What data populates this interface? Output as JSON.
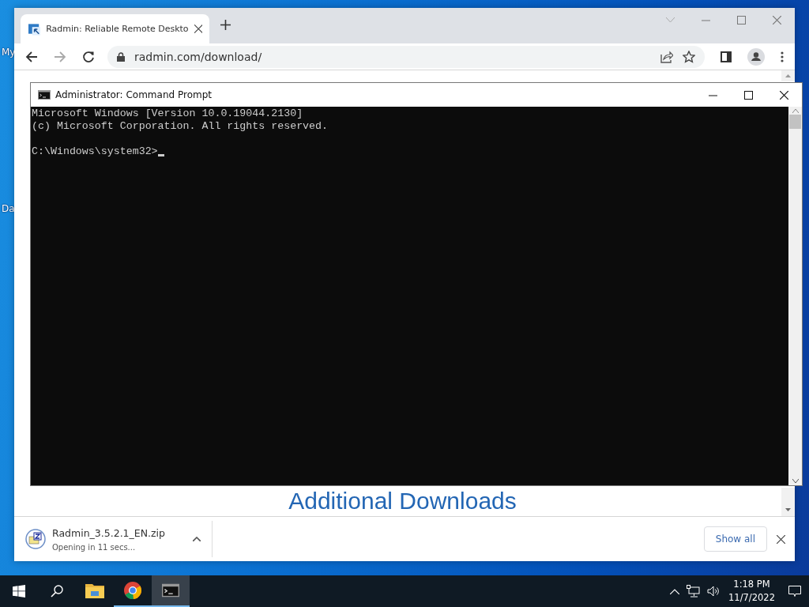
{
  "desktop": {
    "icons": [
      {
        "label": "My"
      },
      {
        "label": "Da"
      }
    ]
  },
  "browser": {
    "tabs": [
      {
        "title": "Radmin: Reliable Remote Deskto",
        "selected": true
      }
    ],
    "url": "radmin.com/download/",
    "page": {
      "heading": "Additional Downloads"
    },
    "download": {
      "filename": "Radmin_3.5.2.1_EN.zip",
      "status": "Opening in 11 secs...",
      "button": "Show all"
    }
  },
  "console": {
    "title": "Administrator: Command Prompt",
    "output": [
      "Microsoft Windows [Version 10.0.19044.2130]",
      "(c) Microsoft Corporation. All rights reserved."
    ],
    "prompt": "C:\\Windows\\system32>"
  },
  "taskbar": {
    "apps": [
      {
        "kind": "explorer",
        "selected": false,
        "running": false
      },
      {
        "kind": "chrome",
        "selected": false,
        "running": true
      },
      {
        "kind": "console",
        "selected": true,
        "running": true
      }
    ],
    "time": "1:18 PM",
    "date": "11/7/2022"
  }
}
